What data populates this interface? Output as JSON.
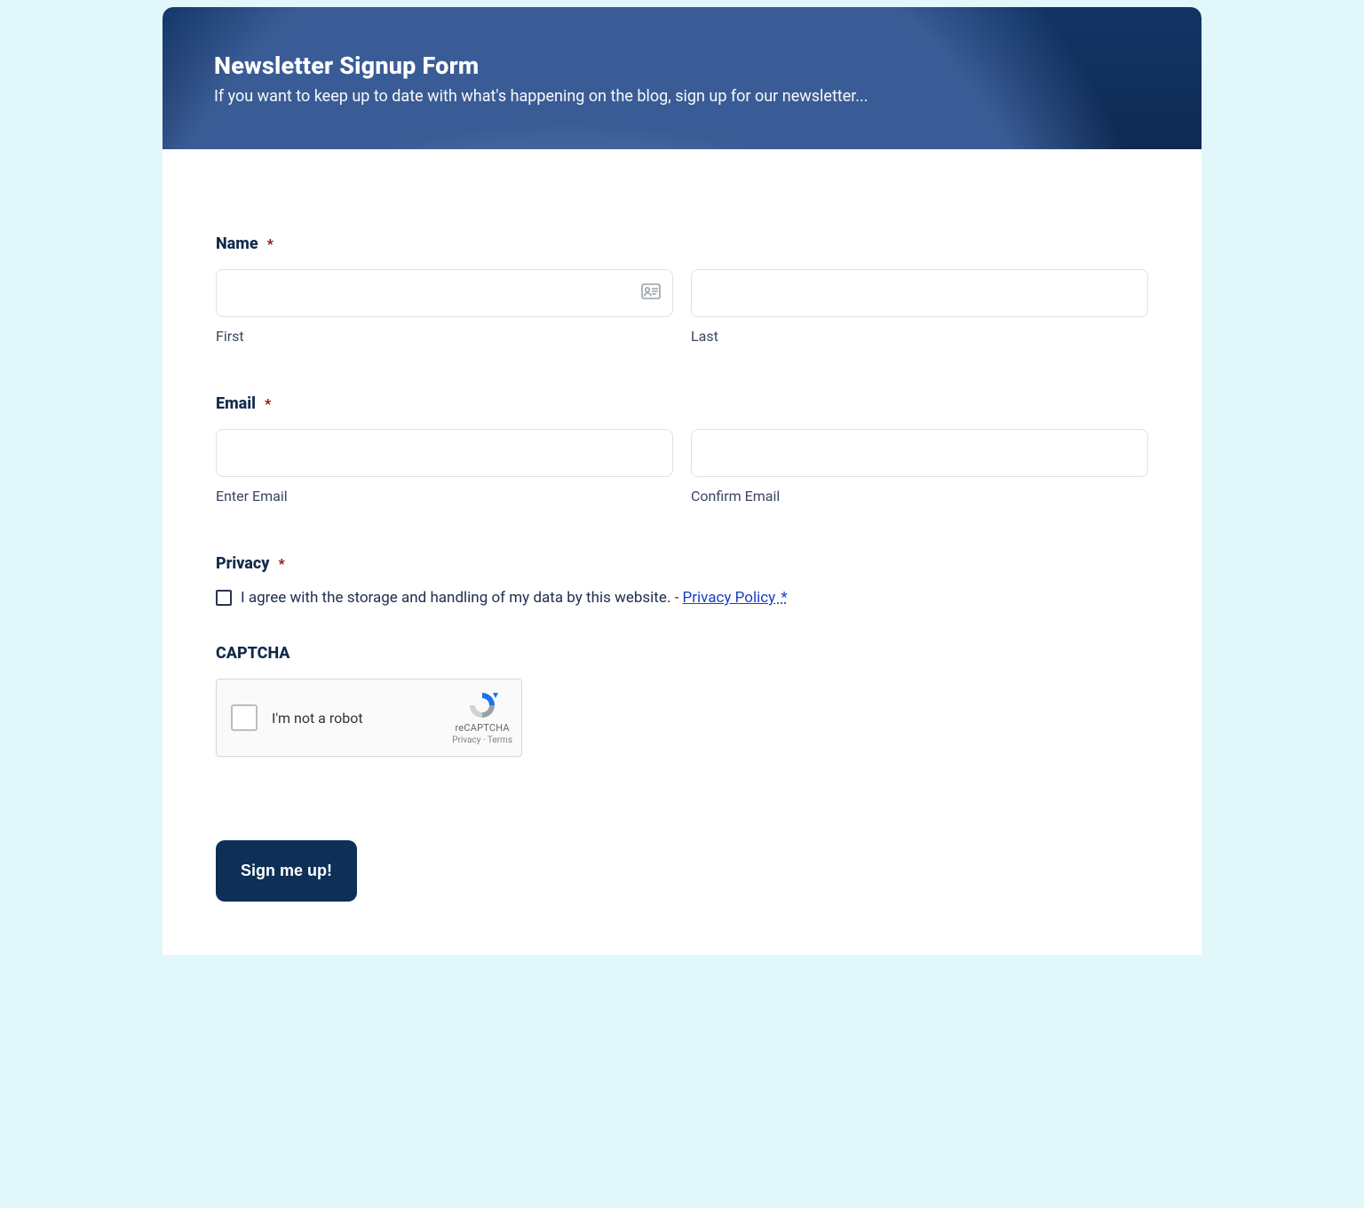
{
  "hero": {
    "title": "Newsletter Signup Form",
    "subtitle": "If you want to keep up to date with what's happening on the blog, sign up for our newsletter..."
  },
  "form": {
    "name": {
      "label": "Name",
      "required_mark": "*",
      "first_sublabel": "First",
      "last_sublabel": "Last",
      "first_value": "",
      "last_value": ""
    },
    "email": {
      "label": "Email",
      "required_mark": "*",
      "enter_sublabel": "Enter Email",
      "confirm_sublabel": "Confirm Email",
      "enter_value": "",
      "confirm_value": ""
    },
    "privacy": {
      "label": "Privacy",
      "required_mark": "*",
      "agree_text": "I agree with the storage and handling of my data by this website. - ",
      "policy_link_text": "Privacy Policy",
      "policy_star": " *"
    },
    "captcha": {
      "label": "CAPTCHA",
      "checkbox_label": "I'm not a robot",
      "brand": "reCAPTCHA",
      "links_text": "Privacy  ·  Terms"
    },
    "submit_label": "Sign me up!"
  }
}
